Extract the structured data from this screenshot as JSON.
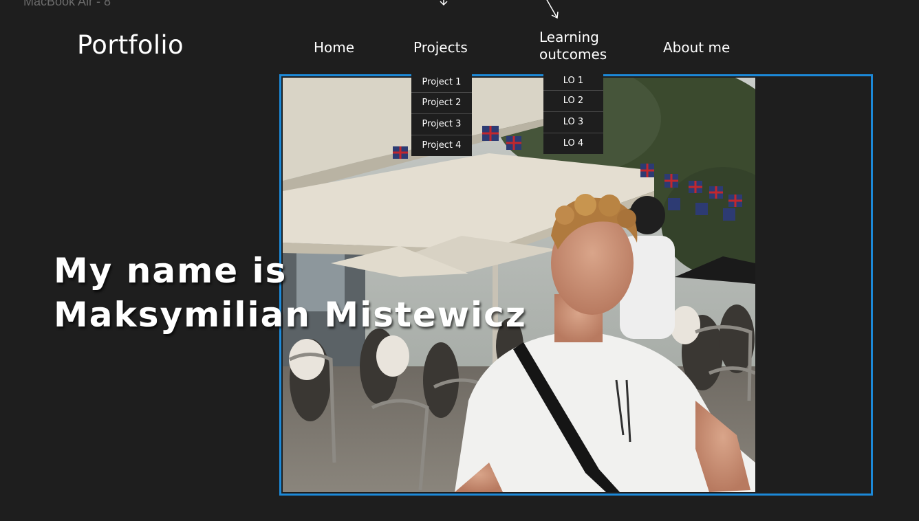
{
  "frame_label": "MacBook Air - 8",
  "brand": {
    "title": "Portfolio"
  },
  "nav": {
    "home": "Home",
    "projects": "Projects",
    "learning_line1": "Learning",
    "learning_line2": "outcomes",
    "about": "About me"
  },
  "projects_menu": [
    "Project 1",
    "Project 2",
    "Project 3",
    "Project 4"
  ],
  "lo_menu": [
    "LO 1",
    "LO 2",
    "LO 3",
    "LO 4"
  ],
  "hero": {
    "line1": "My name is",
    "line2": "Maksymilian Mistewicz"
  },
  "colors": {
    "background": "#1e1e1e",
    "frame_border": "#1c89d8",
    "text": "#ffffff"
  }
}
